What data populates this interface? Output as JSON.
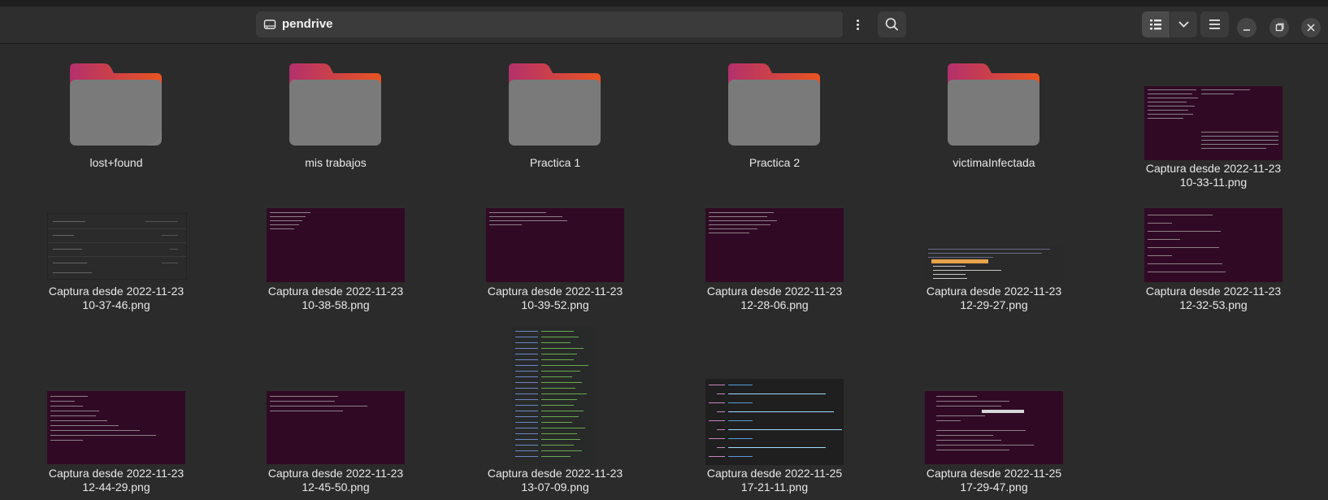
{
  "header": {
    "location": "pendrive",
    "icons": {
      "drive": "drive-icon",
      "menu": "vertical-dots-icon",
      "search": "search-icon",
      "list_view": "list-view-icon",
      "view_options": "chevron-down-icon",
      "sort": "hamburger-menu-icon",
      "minimize": "minimize-icon",
      "maximize": "maximize-icon",
      "close": "close-icon"
    }
  },
  "colors": {
    "folder_top": "#e95420",
    "folder_accent": "#c7317e",
    "folder_body": "#7b7b7b",
    "terminal_bg": "#300a24"
  },
  "folders": [
    {
      "name": "lost+found"
    },
    {
      "name": "mis trabajos"
    },
    {
      "name": "Practica 1"
    },
    {
      "name": "Practica 2"
    },
    {
      "name": "victimaInfectada"
    }
  ],
  "files": [
    {
      "line1": "Captura desde 2022-11-23",
      "line2": "10-33-11.png"
    },
    {
      "line1": "Captura desde 2022-11-23",
      "line2": "10-37-46.png"
    },
    {
      "line1": "Captura desde 2022-11-23",
      "line2": "10-38-58.png"
    },
    {
      "line1": "Captura desde 2022-11-23",
      "line2": "10-39-52.png"
    },
    {
      "line1": "Captura desde 2022-11-23",
      "line2": "12-28-06.png"
    },
    {
      "line1": "Captura desde 2022-11-23",
      "line2": "12-29-27.png"
    },
    {
      "line1": "Captura desde 2022-11-23",
      "line2": "12-32-53.png"
    },
    {
      "line1": "Captura desde 2022-11-23",
      "line2": "12-44-29.png"
    },
    {
      "line1": "Captura desde 2022-11-23",
      "line2": "12-45-50.png"
    },
    {
      "line1": "Captura desde 2022-11-23",
      "line2": "13-07-09.png"
    },
    {
      "line1": "Captura desde 2022-11-25",
      "line2": "17-21-11.png"
    },
    {
      "line1": "Captura desde 2022-11-25",
      "line2": "17-29-47.png"
    }
  ]
}
